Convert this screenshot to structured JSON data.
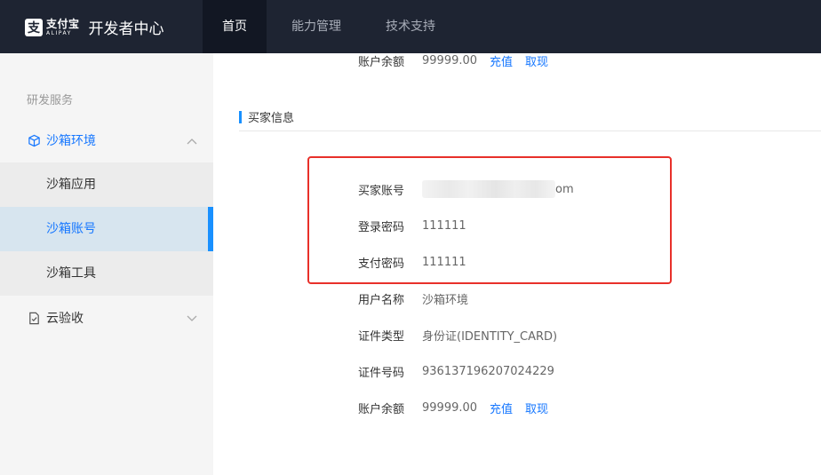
{
  "header": {
    "logo_cn": "支付宝",
    "logo_en": "ALIPAY",
    "title": "开发者中心",
    "nav": [
      {
        "label": "首页",
        "active": true
      },
      {
        "label": "能力管理",
        "active": false
      },
      {
        "label": "技术支持",
        "active": false
      }
    ]
  },
  "sidebar": {
    "section_title": "研发服务",
    "group_sandbox": {
      "label": "沙箱环境",
      "icon": "cube-icon",
      "expanded": true
    },
    "sub_items": [
      {
        "label": "沙箱应用"
      },
      {
        "label": "沙箱账号",
        "active": true
      },
      {
        "label": "沙箱工具"
      }
    ],
    "group_cloud": {
      "label": "云验收",
      "icon": "document-check-icon",
      "expanded": false
    }
  },
  "main": {
    "seller_balance": {
      "label": "账户余额",
      "value": "99999.00",
      "recharge": "充值",
      "withdraw": "取现"
    },
    "buyer_section_title": "买家信息",
    "buyer": {
      "account_label": "买家账号",
      "account_suffix": "om",
      "login_pw_label": "登录密码",
      "login_pw": "111111",
      "pay_pw_label": "支付密码",
      "pay_pw": "111111",
      "username_label": "用户名称",
      "username": "沙箱环境",
      "id_type_label": "证件类型",
      "id_type": "身份证(IDENTITY_CARD)",
      "id_no_label": "证件号码",
      "id_no": "936137196207024229",
      "balance_label": "账户余额",
      "balance": "99999.00",
      "recharge": "充值",
      "withdraw": "取现"
    }
  },
  "colors": {
    "topbar": "#1e2432",
    "accent": "#1677ff",
    "highlight_border": "#e8302a"
  }
}
